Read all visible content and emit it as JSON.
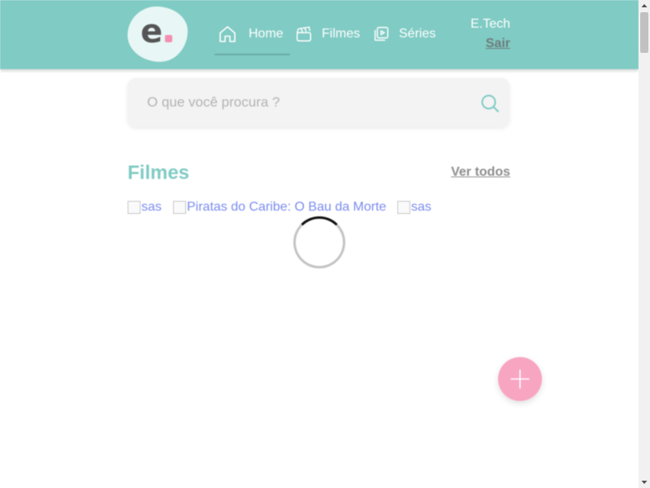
{
  "header": {
    "logo_letter": "e",
    "nav": [
      {
        "label": "Home",
        "icon": "home-icon"
      },
      {
        "label": "Filmes",
        "icon": "clapperboard-icon"
      },
      {
        "label": "Séries",
        "icon": "video-library-icon"
      }
    ],
    "user_name": "E.Tech",
    "logout_label": "Sair"
  },
  "search": {
    "placeholder": "O que você procura ?",
    "value": ""
  },
  "section": {
    "title": "Filmes",
    "see_all_label": "Ver todos"
  },
  "posters": [
    {
      "alt": "sas"
    },
    {
      "alt": "Piratas do Caribe: O Bau da Morte"
    },
    {
      "alt": "sas"
    }
  ],
  "colors": {
    "header_bg": "#80cbc4",
    "accent": "#80cbc4",
    "fab": "#f8a5c2",
    "logo_dot": "#f48fb1"
  }
}
